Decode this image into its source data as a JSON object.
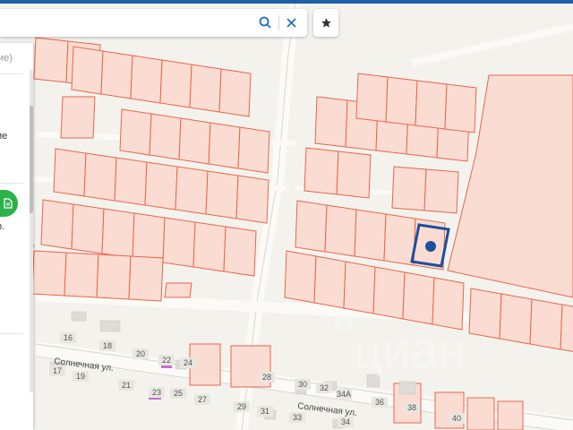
{
  "colors": {
    "parcel_fill": "#fbdcd2",
    "parcel_stroke": "#e8664a",
    "selected_stroke": "#1d4f9c",
    "marker": "#1d4f9c",
    "road": "#faf8f3",
    "highlight_building": "#c86bd6",
    "building_gray": "#dedcd8",
    "top_bar": "#1f5fa5",
    "doc_button": "#2db24a"
  },
  "search": {
    "value": "",
    "search_icon": "search-icon",
    "clear_icon": "close-icon"
  },
  "favorites_icon": "star-icon",
  "panel": {
    "fragments": [
      "ие)",
      "ие",
      "р."
    ],
    "doc_icon": "document-icon"
  },
  "streets": [
    "Солнечная ул.",
    "Солнечная ул."
  ],
  "house_numbers": [
    "16",
    "18",
    "20",
    "22",
    "24",
    "17",
    "19",
    "21",
    "23",
    "25",
    "27",
    "28",
    "29",
    "30",
    "31",
    "32",
    "33",
    "34А",
    "34",
    "36",
    "38",
    "40"
  ],
  "watermark": "циан"
}
